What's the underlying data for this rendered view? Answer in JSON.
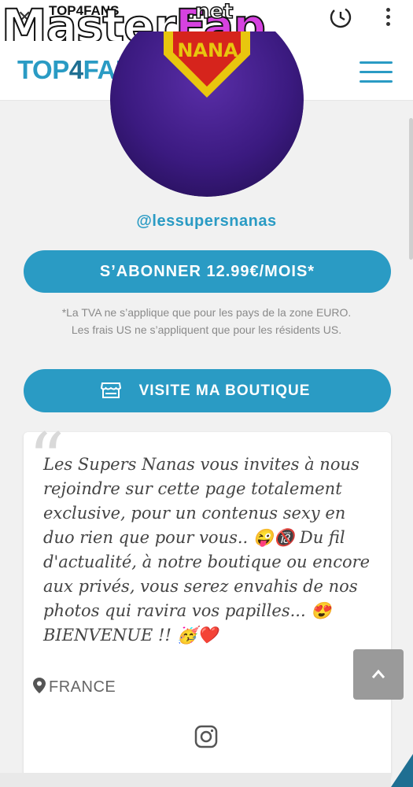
{
  "browser": {
    "tab_title": "TOP4FANS",
    "close_icon": "close-icon",
    "history_icon": "history-icon",
    "menu_icon": "kebab-menu-icon"
  },
  "watermark": {
    "text_part1": "Master",
    "text_part2": "Fap",
    "suffix": ".net"
  },
  "site": {
    "logo_part1": "TOP",
    "logo_part2": "4",
    "logo_part3": "FANS",
    "menu_icon": "hamburger-icon",
    "brand_color": "#2a9bc4"
  },
  "profile": {
    "avatar_text": "NANA",
    "username": "@lessupersnanas",
    "subscribe_label": "S’ABONNER 12.99€/MOIS*",
    "tva_note_line1": "*La TVA ne s’applique que pour les pays de la zone EURO.",
    "tva_note_line2": "Les frais US ne s’appliquent que pour les résidents US.",
    "shop_label": "VISITE MA BOUTIQUE",
    "shop_icon": "store-icon"
  },
  "bio": {
    "quote_mark": "“",
    "text": "Les Supers Nanas vous invites à nous rejoindre sur cette page totalement exclusive, pour un contenus sexy en duo rien que pour vous.. 😜🔞 Du fil d'actualité, à notre boutique ou encore aux privés, vous serez envahis de nos photos qui ravira vos papilles... 😍 BIENVENUE !! 🥳❤️",
    "location": "FRANCE",
    "location_icon": "map-pin-icon",
    "social_icon": "instagram-icon"
  },
  "controls": {
    "scroll_top_icon": "chevron-up-icon"
  }
}
